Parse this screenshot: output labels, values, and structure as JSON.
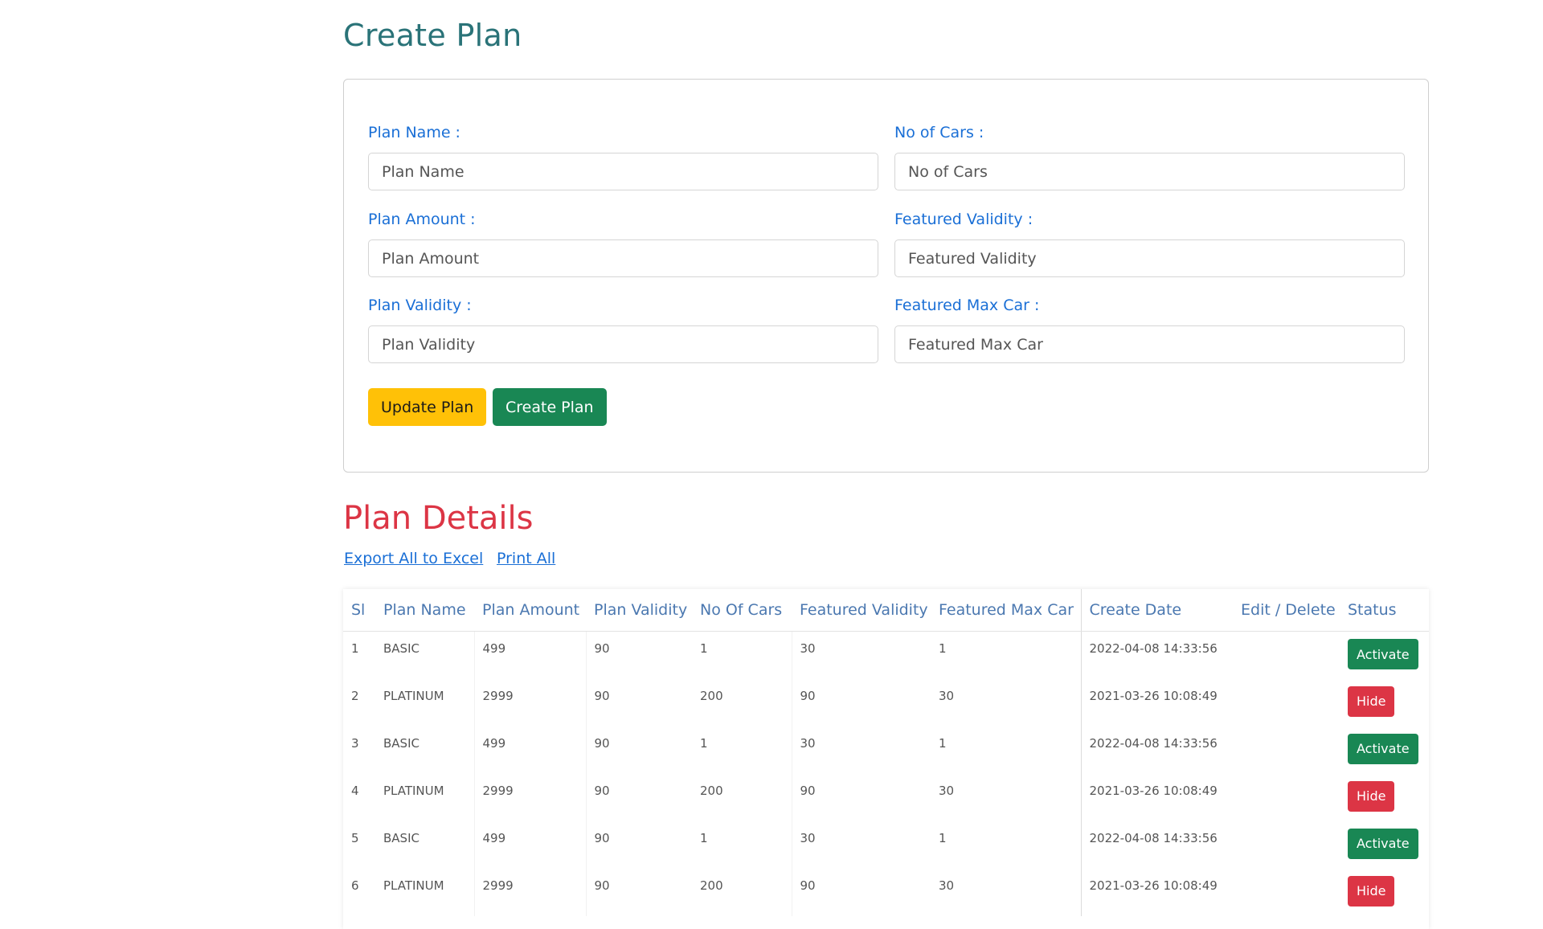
{
  "create_section": {
    "title": "Create Plan",
    "fields": {
      "plan_name": {
        "label": "Plan Name :",
        "placeholder": "Plan Name"
      },
      "no_of_cars": {
        "label": "No of Cars :",
        "placeholder": "No of Cars"
      },
      "plan_amount": {
        "label": "Plan Amount :",
        "placeholder": "Plan Amount"
      },
      "featured_validity": {
        "label": "Featured Validity :",
        "placeholder": "Featured Validity"
      },
      "plan_validity": {
        "label": "Plan Validity :",
        "placeholder": "Plan Validity"
      },
      "featured_max_car": {
        "label": "Featured Max Car :",
        "placeholder": "Featured Max Car"
      }
    },
    "buttons": {
      "update": "Update Plan",
      "create": "Create Plan"
    }
  },
  "details_section": {
    "title": "Plan Details",
    "links": {
      "export": "Export All to Excel",
      "print": "Print All"
    },
    "columns": [
      "Sl",
      "Plan Name",
      "Plan Amount",
      "Plan Validity",
      "No Of Cars",
      "Featured Validity",
      "Featured Max Car",
      "Create Date",
      "Edit / Delete",
      "Status"
    ],
    "rows": [
      {
        "sl": "1",
        "name": "BASIC",
        "amount": "499",
        "validity": "90",
        "cars": "1",
        "fvalidity": "30",
        "fmax": "1",
        "date": "2022-04-08 14:33:56",
        "edit": "",
        "status": "Activate"
      },
      {
        "sl": "2",
        "name": "PLATINUM",
        "amount": "2999",
        "validity": "90",
        "cars": "200",
        "fvalidity": "90",
        "fmax": "30",
        "date": "2021-03-26 10:08:49",
        "edit": "",
        "status": "Hide"
      },
      {
        "sl": "3",
        "name": "BASIC",
        "amount": "499",
        "validity": "90",
        "cars": "1",
        "fvalidity": "30",
        "fmax": "1",
        "date": "2022-04-08 14:33:56",
        "edit": "",
        "status": "Activate"
      },
      {
        "sl": "4",
        "name": "PLATINUM",
        "amount": "2999",
        "validity": "90",
        "cars": "200",
        "fvalidity": "90",
        "fmax": "30",
        "date": "2021-03-26 10:08:49",
        "edit": "",
        "status": "Hide"
      },
      {
        "sl": "5",
        "name": "BASIC",
        "amount": "499",
        "validity": "90",
        "cars": "1",
        "fvalidity": "30",
        "fmax": "1",
        "date": "2022-04-08 14:33:56",
        "edit": "",
        "status": "Activate"
      },
      {
        "sl": "6",
        "name": "PLATINUM",
        "amount": "2999",
        "validity": "90",
        "cars": "200",
        "fvalidity": "90",
        "fmax": "30",
        "date": "2021-03-26 10:08:49",
        "edit": "",
        "status": "Hide"
      }
    ]
  },
  "colors": {
    "create_title": "#2a7378",
    "details_title": "#dc3545",
    "label": "#1a6fd6",
    "update_button": "#ffc107",
    "create_button": "#198754",
    "activate": "#198754",
    "hide": "#dc3545",
    "header_text": "#4b78b0"
  }
}
